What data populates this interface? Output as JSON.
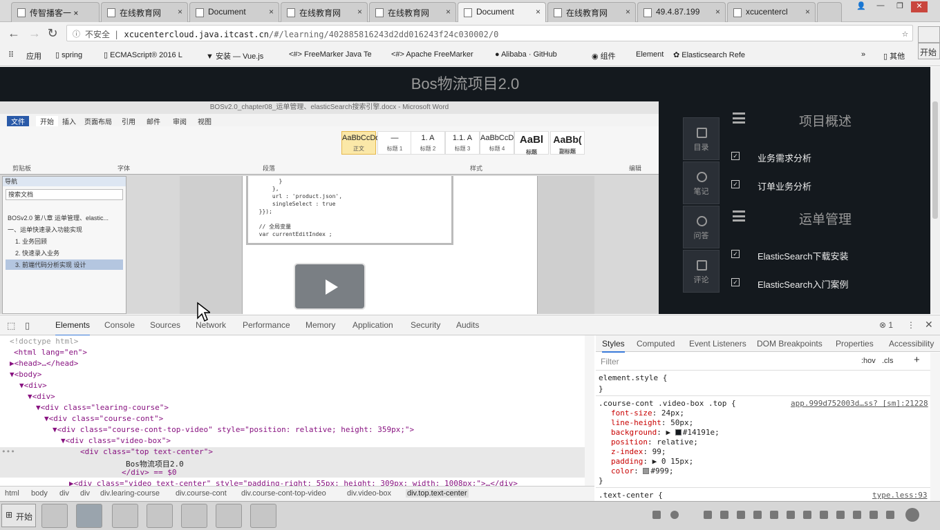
{
  "browser": {
    "tabs": [
      {
        "label": "传智播客一 ×"
      },
      {
        "label": "在线教育网"
      },
      {
        "label": "Document"
      },
      {
        "label": "在线教育网"
      },
      {
        "label": "在线教育网"
      },
      {
        "label": "Document"
      },
      {
        "label": "在线教育网"
      },
      {
        "label": "49.4.87.199"
      },
      {
        "label": "xcucentercl"
      }
    ],
    "address": {
      "insecure": "不安全",
      "separator": "|",
      "host": "xcucentercloud.java.itcast.cn",
      "path": "/#/learning/402885816243d2dd016243f24c030002/0"
    },
    "bookmarks": [
      {
        "label": "应用"
      },
      {
        "label": "spring"
      },
      {
        "label": "ECMAScript® 2016 L"
      },
      {
        "label": "安装 — Vue.js"
      },
      {
        "label": "FreeMarker Java Te"
      },
      {
        "label": "Apache FreeMarker"
      },
      {
        "label": "Alibaba · GitHub"
      },
      {
        "label": "组件"
      },
      {
        "label": "Element"
      },
      {
        "label": "Elasticsearch Refe"
      },
      {
        "label": "其他"
      }
    ],
    "right_button": "开始"
  },
  "page": {
    "video_title": "Bos物流项目2.0",
    "word": {
      "title": "BOSv2.0_chapter08_运单管理、elasticSearch搜索引擎.docx - Microsoft Word",
      "tabs": [
        "文件",
        "开始",
        "插入",
        "页面布局",
        "引用",
        "邮件",
        "审阅",
        "视图"
      ],
      "groups": [
        "剪贴板",
        "字体",
        "段落",
        "样式",
        "编辑"
      ],
      "styles": [
        {
          "sample": "AaBbCcDd",
          "name": "正文"
        },
        {
          "sample": "—",
          "name": "标题 1"
        },
        {
          "sample": "1. A",
          "name": "标题 2"
        },
        {
          "sample": "1.1. A",
          "name": "标题 3"
        },
        {
          "sample": "AaBbCcD",
          "name": "标题 4"
        },
        {
          "sample": "AaBl",
          "name": "标题"
        },
        {
          "sample": "AaBb(",
          "name": "副标题"
        }
      ],
      "nav": {
        "header": "导航",
        "search": "搜索文档",
        "items": [
          "BOSv2.0 第八章 运单管理、elastic...",
          "一、运单快速录入功能实现",
          "1. 业务回顾",
          "2. 快速录入业务",
          "3. 前端代码分析实现 设计"
        ]
      },
      "code": "        }\n      },\n      url : 'product.json',\n      singleSelect : true\n  }});\n\n  // 全局变量\n  var currentEditIndex ;"
    },
    "sidebar_buttons": [
      {
        "label": "目录"
      },
      {
        "label": "笔记"
      },
      {
        "label": "问答"
      },
      {
        "label": "评论"
      }
    ],
    "chapters": [
      {
        "title": "项目概述",
        "lessons": [
          "业务需求分析",
          "订单业务分析"
        ]
      },
      {
        "title": "运单管理",
        "lessons": [
          "ElasticSearch下载安装",
          "ElasticSearch入门案例"
        ]
      }
    ]
  },
  "devtools": {
    "tabs": [
      "Elements",
      "Console",
      "Sources",
      "Network",
      "Performance",
      "Memory",
      "Application",
      "Security",
      "Audits"
    ],
    "error_count": "1",
    "dom": [
      {
        "text": "<!doctype html>"
      },
      {
        "text": "<html lang=\"en\">"
      },
      {
        "text": "▶<head>…</head>"
      },
      {
        "text": "▼<body>"
      },
      {
        "text": "▼<div>"
      },
      {
        "text": "▼<div>"
      },
      {
        "text": "▼<div class=\"learing-course\">"
      },
      {
        "text": "▼<div class=\"course-cont\">"
      },
      {
        "text": "▼<div class=\"course-cont-top-video\" style=\"position: relative; height: 359px;\">"
      },
      {
        "text": "▼<div class=\"video-box\">"
      },
      {
        "text": "<div class=\"top text-center\">"
      },
      {
        "text": "Bos物流项目2.0"
      },
      {
        "text": "</div> == $0"
      },
      {
        "text": "▶<div class=\"video text-center\" style=\"padding-right: 55px; height: 309px; width: 1008px;\">…</div>"
      }
    ],
    "crumbs": [
      "html",
      "body",
      "div",
      "div",
      "div.learing-course",
      "div.course-cont",
      "div.course-cont-top-video",
      "div.video-box",
      "div.top.text-center"
    ],
    "styles_tabs": [
      "Styles",
      "Computed",
      "Event Listeners",
      "DOM Breakpoints",
      "Properties",
      "Accessibility"
    ],
    "filter": "Filter",
    "hov": ":hov",
    "cls": ".cls",
    "element_style": "element.style {",
    "close_brace": "}",
    "rule": {
      "selector": ".course-cont .video-box .top {",
      "source": "app.999d752003d…ss? [sm]:21228",
      "props": [
        {
          "name": "font-size",
          "value": "24px;"
        },
        {
          "name": "line-height",
          "value": "50px;"
        },
        {
          "name": "background",
          "value": "#14191e;"
        },
        {
          "name": "position",
          "value": "relative;"
        },
        {
          "name": "z-index",
          "value": "99;"
        },
        {
          "name": "padding",
          "value": "0 15px;"
        },
        {
          "name": "color",
          "value": "#999;"
        }
      ]
    },
    "rule2": {
      "selector": ".text-center {",
      "source": "type.less:93"
    }
  },
  "taskbar": {
    "start": "开始"
  },
  "colors": {
    "video_bg": "#14191e",
    "title": "#999999",
    "accent": "#3879d9"
  }
}
